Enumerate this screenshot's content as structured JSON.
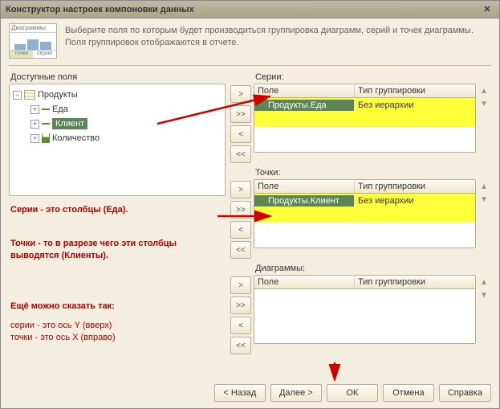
{
  "title": "Конструктор настроек компоновки данных",
  "thumb": {
    "tab": "Диаграммы",
    "axis_x": "точки",
    "axis_y": "серии"
  },
  "desc_line1": "Выберите поля по которым будет производиться группировка диаграмм, серий и точек диаграммы.",
  "desc_line2": "Поля группировок отображаются в отчете.",
  "available_label": "Доступные поля",
  "fields": {
    "root": "Продукты",
    "children": [
      "Еда",
      "Клиент",
      "Количество"
    ]
  },
  "series": {
    "label": "Серии:",
    "col_field": "Поле",
    "col_group": "Тип группировки",
    "row_field": "Продукты.Еда",
    "row_group": "Без иерархии"
  },
  "points": {
    "label": "Точки:",
    "col_field": "Поле",
    "col_group": "Тип группировки",
    "row_field": "Продукты.Клиент",
    "row_group": "Без иерархии"
  },
  "diagrams": {
    "label": "Диаграммы:",
    "col_field": "Поле",
    "col_group": "Тип группировки"
  },
  "move": {
    "r": ">",
    "rr": ">>",
    "l": "<",
    "ll": "<<"
  },
  "annot1": "Серии - это столбцы (Еда).",
  "annot2a": "Точки - то в разрезе чего эти столбцы",
  "annot2b": "выводятся (Клиенты).",
  "annot3": "Ещё можно сказать так:",
  "annot4": "серии - это ось Y (вверх)",
  "annot5": "точки - это ось X (вправо)",
  "buttons": {
    "back": "< Назад",
    "next": "Далее >",
    "ok": "ОК",
    "cancel": "Отмена",
    "help": "Справка"
  }
}
